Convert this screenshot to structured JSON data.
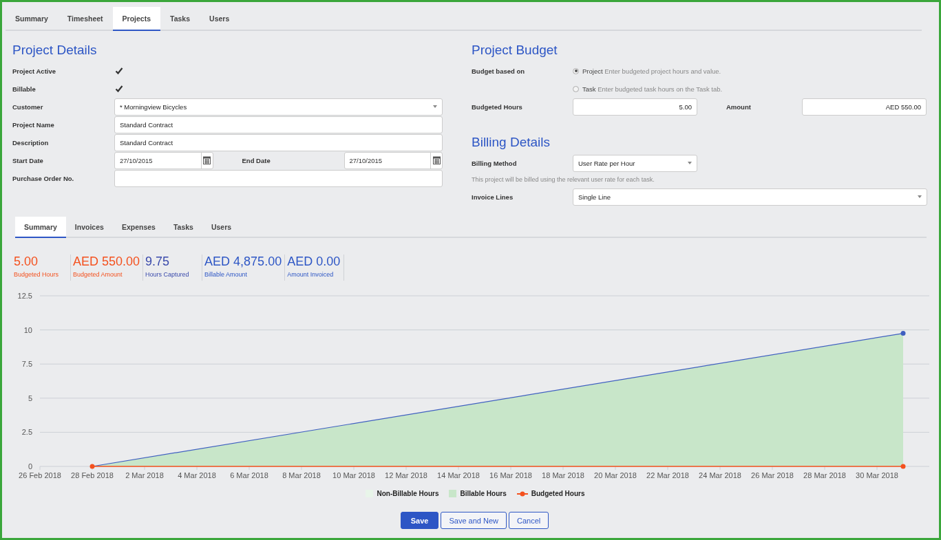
{
  "main_tabs": [
    {
      "label": "Summary",
      "selected": false
    },
    {
      "label": "Timesheet",
      "selected": false
    },
    {
      "label": "Projects",
      "selected": true
    },
    {
      "label": "Tasks",
      "selected": false
    },
    {
      "label": "Users",
      "selected": false
    }
  ],
  "project_details": {
    "title": "Project Details",
    "fields": [
      {
        "kind": "checkbox",
        "label": "Project Active",
        "checked": true
      },
      {
        "kind": "checkbox",
        "label": "Billable",
        "checked": true
      },
      {
        "kind": "select",
        "label": "Customer",
        "value": "* Morningview Bicycles"
      },
      {
        "kind": "text",
        "label": "Project Name",
        "value": "Standard Contract"
      },
      {
        "kind": "text",
        "label": "Description",
        "value": "Standard Contract"
      },
      {
        "kind": "date_range",
        "label": "Start Date",
        "value": "27/10/2015",
        "second_label": "End Date",
        "second_value": "27/10/2015"
      },
      {
        "kind": "text",
        "label": "Purchase Order No."
      }
    ]
  },
  "project_budget": {
    "title": "Project Budget",
    "based_on_label": "Budget based on",
    "options": [
      {
        "label": "Project",
        "hint": "Enter budgeted project hours and value.",
        "selected": true
      },
      {
        "label": "Task",
        "hint": "Enter budgeted task hours on the Task tab.",
        "selected": false
      }
    ],
    "hours_label": "Budgeted Hours",
    "hours": "5.00",
    "amount_label": "Amount",
    "amount": "AED 550.00"
  },
  "billing_details": {
    "title": "Billing Details",
    "method_label": "Billing Method",
    "method": "User Rate per Hour",
    "note": "This project will be billed using the relevant user rate for each task.",
    "invoice_lines_label": "Invoice Lines",
    "invoice_lines": "Single Line"
  },
  "sub_tabs": [
    {
      "label": "Summary",
      "selected": true
    },
    {
      "label": "Invoices",
      "selected": false
    },
    {
      "label": "Expenses",
      "selected": false
    },
    {
      "label": "Tasks",
      "selected": false
    },
    {
      "label": "Users",
      "selected": false
    }
  ],
  "stats": [
    {
      "value": "5.00",
      "label": "Budgeted Hours",
      "color": "#f4511e"
    },
    {
      "value": "AED 550.00",
      "label": "Budgeted Amount",
      "color": "#f4511e"
    },
    {
      "value": "9.75",
      "label": "Hours Captured",
      "color": "#3949ab"
    },
    {
      "value": "AED 4,875.00",
      "label": "Billable Amount",
      "color": "#2d56c5"
    },
    {
      "value": "AED 0.00",
      "label": "Amount Invoiced",
      "color": "#2d56c5"
    }
  ],
  "chart_data": {
    "type": "area",
    "grid": true,
    "categories": [
      "26 Feb 2018",
      null,
      "28 Feb 2018",
      null,
      "2 Mar 2018",
      null,
      "4 Mar 2018",
      null,
      "6 Mar 2018",
      null,
      "8 Mar 2018",
      null,
      "10 Mar 2018",
      null,
      "12 Mar 2018",
      null,
      "14 Mar 2018",
      null,
      "16 Mar 2018",
      null,
      "18 Mar 2018",
      null,
      "20 Mar 2018",
      null,
      "22 Mar 2018",
      null,
      "24 Mar 2018",
      null,
      "26 Mar 2018",
      null,
      "28 Mar 2018",
      null,
      "30 Mar 2018",
      null,
      null
    ],
    "ylim": [
      0,
      12.5
    ],
    "yticks": [
      0,
      2.5,
      5,
      7.5,
      10,
      12.5
    ],
    "series": [
      {
        "name": "Non-Billable Hours",
        "color": "#e8f5e9",
        "values": [
          null,
          null,
          null,
          null,
          null,
          null,
          null,
          null,
          null,
          null,
          null,
          null,
          null,
          null,
          null,
          null,
          null,
          null,
          null,
          null,
          null,
          null,
          null,
          null,
          null,
          null,
          null,
          null,
          null,
          null,
          null,
          null,
          null,
          null,
          null
        ]
      },
      {
        "name": "Billable Hours",
        "color": "#c8e6c9",
        "values": [
          null,
          null,
          0,
          null,
          null,
          null,
          null,
          null,
          null,
          null,
          null,
          null,
          null,
          null,
          null,
          null,
          null,
          null,
          null,
          null,
          null,
          null,
          null,
          null,
          null,
          null,
          null,
          null,
          null,
          null,
          null,
          null,
          null,
          9.75,
          null
        ]
      },
      {
        "name": "Budgeted Hours",
        "type": "line",
        "marker": "circle",
        "color": "#f4511e",
        "values": [
          null,
          null,
          0,
          null,
          null,
          null,
          null,
          null,
          null,
          null,
          null,
          null,
          null,
          null,
          null,
          null,
          null,
          null,
          null,
          null,
          null,
          null,
          null,
          null,
          null,
          null,
          null,
          null,
          null,
          null,
          null,
          null,
          null,
          0,
          null
        ]
      }
    ]
  },
  "buttons": [
    {
      "label": "Save",
      "kind": "primary"
    },
    {
      "label": "Save and New",
      "kind": "secondary"
    },
    {
      "label": "Cancel",
      "kind": "secondary"
    }
  ]
}
